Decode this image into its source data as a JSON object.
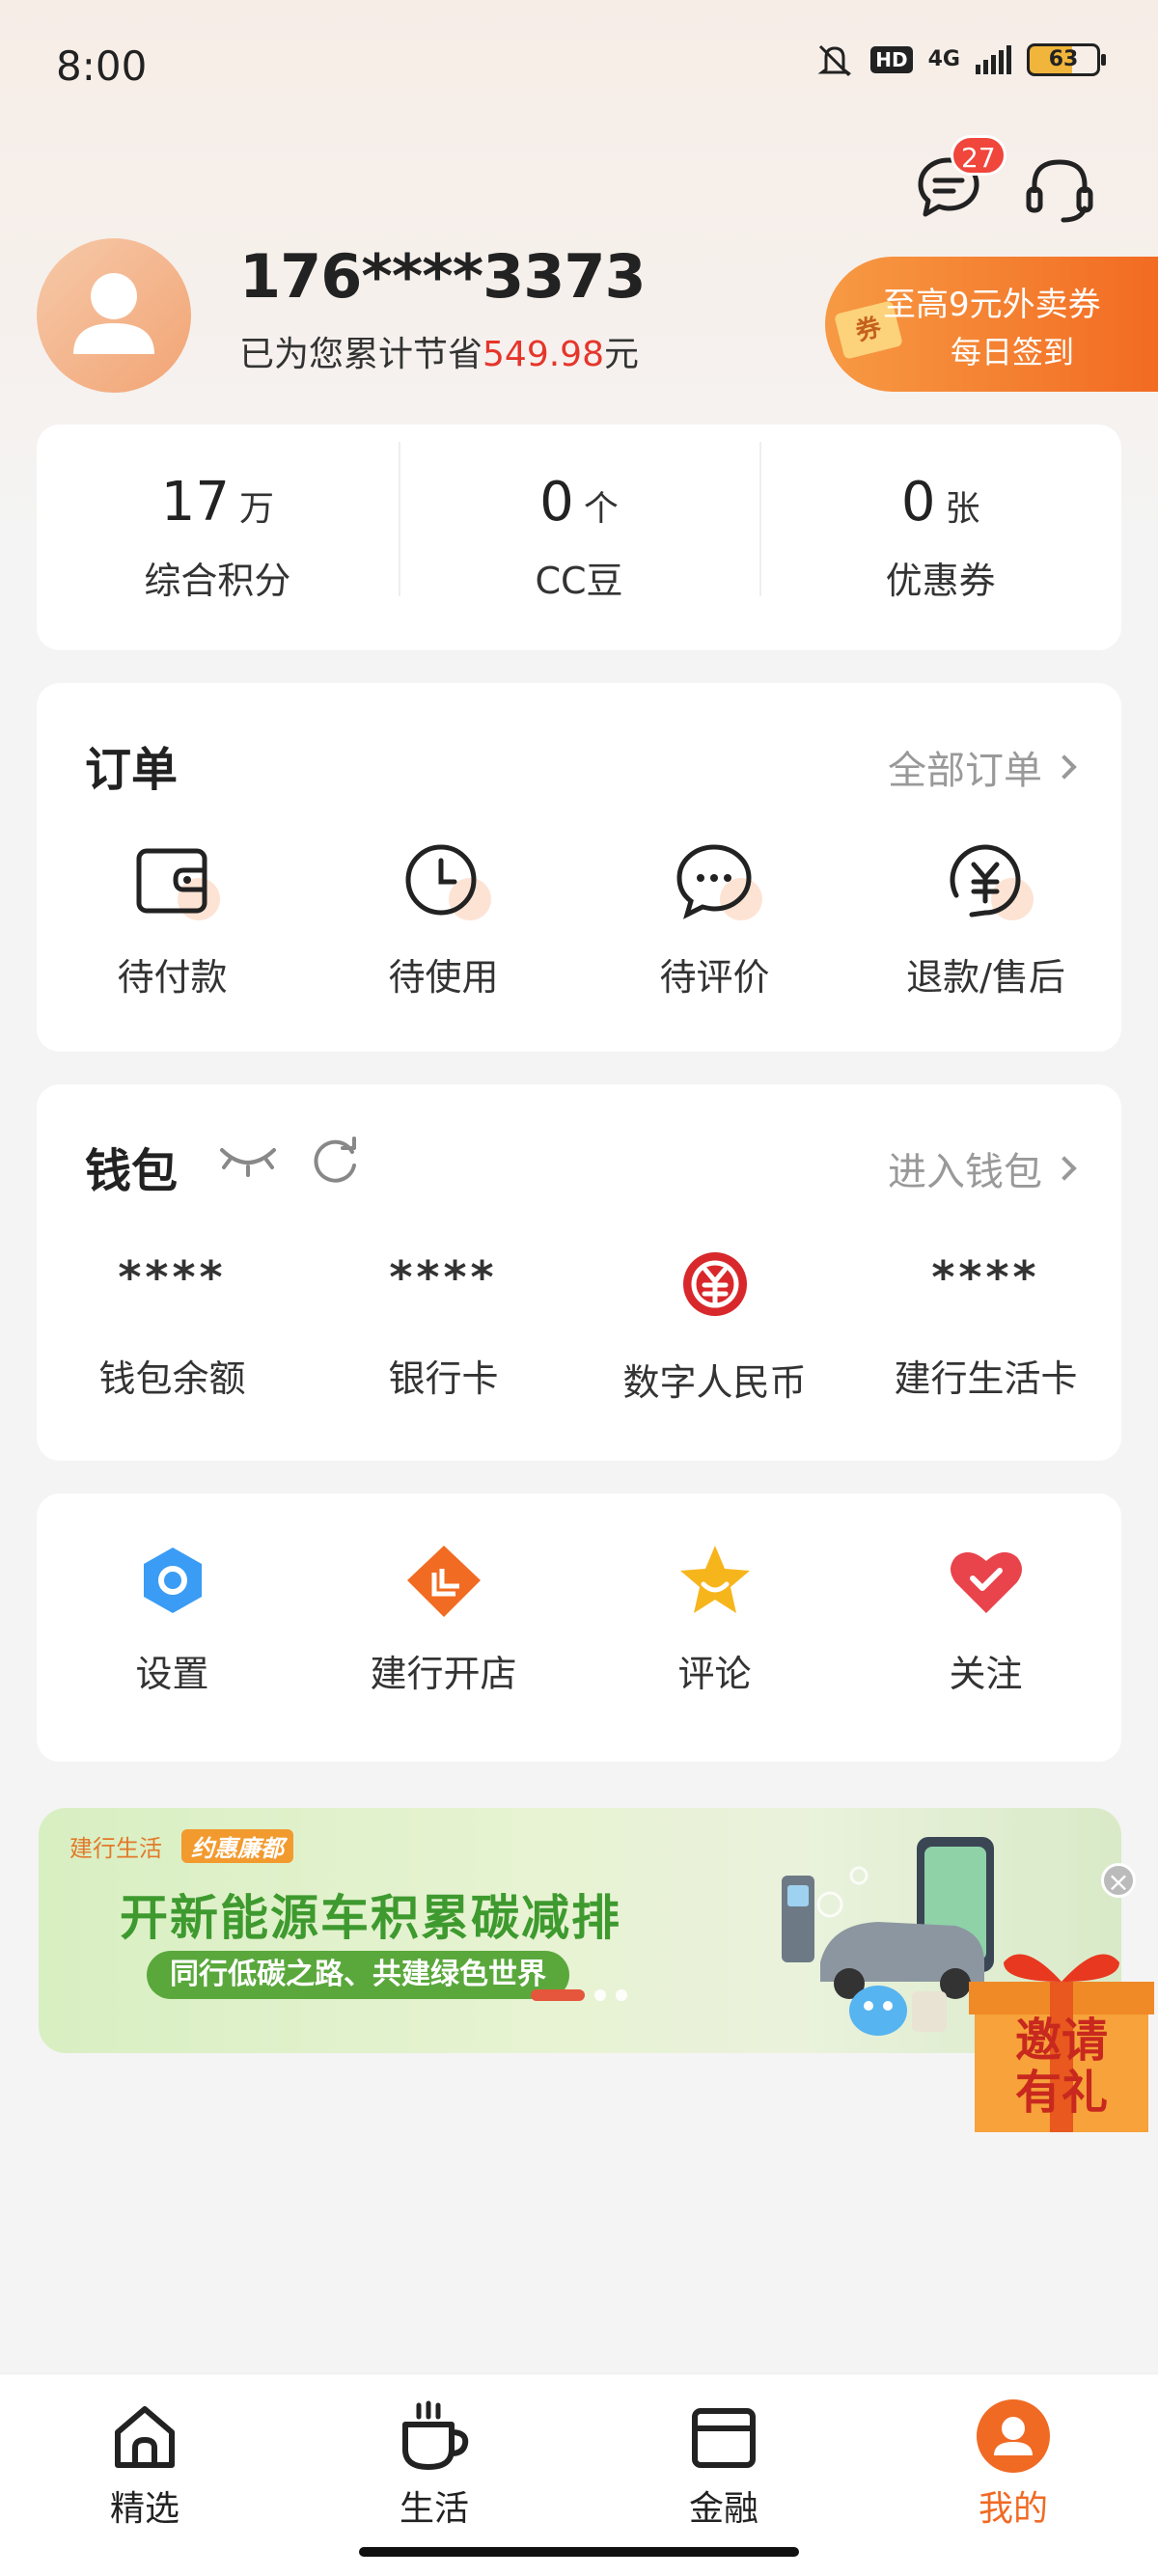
{
  "status_bar": {
    "time": "8:00",
    "network": "4G",
    "hd": "HD",
    "battery": "63",
    "icons": [
      "mute-icon",
      "hd-icon",
      "network-4g-icon",
      "signal-icon",
      "battery-icon"
    ]
  },
  "header": {
    "message_badge": "27",
    "icons": [
      "message-icon",
      "headset-icon"
    ]
  },
  "profile": {
    "phone": "176****3373",
    "saved_prefix": "已为您累计节省",
    "saved_amount": "549.98",
    "saved_suffix": "元",
    "promo_line1": "至高9元外卖券",
    "promo_line2": "每日签到",
    "promo_ticket": "券"
  },
  "stats": [
    {
      "value": "17",
      "unit": "万",
      "label": "综合积分"
    },
    {
      "value": "0",
      "unit": "个",
      "label": "CC豆"
    },
    {
      "value": "0",
      "unit": "张",
      "label": "优惠券"
    }
  ],
  "orders": {
    "title": "订单",
    "link": "全部订单",
    "items": [
      {
        "label": "待付款",
        "icon": "wallet-icon"
      },
      {
        "label": "待使用",
        "icon": "clock-icon"
      },
      {
        "label": "待评价",
        "icon": "comment-icon"
      },
      {
        "label": "退款/售后",
        "icon": "refund-icon"
      }
    ]
  },
  "wallet": {
    "title": "钱包",
    "link": "进入钱包",
    "items": [
      {
        "value": "****",
        "label": "钱包余额"
      },
      {
        "value": "****",
        "label": "银行卡"
      },
      {
        "value": "",
        "label": "数字人民币",
        "icon": "digital-rmb-icon"
      },
      {
        "value": "****",
        "label": "建行生活卡"
      }
    ],
    "colors": {
      "rmb_red": "#d8282b"
    }
  },
  "tools": [
    {
      "label": "设置",
      "icon": "settings-icon",
      "color": "#3a9cf4"
    },
    {
      "label": "建行开店",
      "icon": "shop-icon",
      "color": "#f26b22"
    },
    {
      "label": "评论",
      "icon": "star-icon",
      "color": "#f7b51c"
    },
    {
      "label": "关注",
      "icon": "heart-icon",
      "color": "#e9434b"
    }
  ],
  "banner": {
    "brand1": "建行生活",
    "brand2": "约惠廉都",
    "title": "开新能源车积累碳减排",
    "subtitle": "同行低碳之路、共建绿色世界",
    "close": "×"
  },
  "invite": {
    "text1": "邀请",
    "text2": "有礼"
  },
  "bottom_nav": [
    {
      "label": "精选",
      "icon": "home-icon"
    },
    {
      "label": "生活",
      "icon": "cup-icon"
    },
    {
      "label": "金融",
      "icon": "card-icon"
    },
    {
      "label": "我的",
      "icon": "profile-icon",
      "active": true
    }
  ],
  "accent_color": "#f06a24"
}
